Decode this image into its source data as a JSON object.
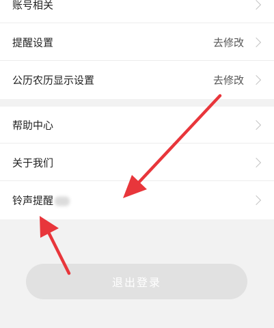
{
  "settings_group_1": [
    {
      "label": "账号相关",
      "value": ""
    },
    {
      "label": "提醒设置",
      "value": "去修改"
    },
    {
      "label": "公历农历显示设置",
      "value": "去修改"
    }
  ],
  "settings_group_2": [
    {
      "label": "帮助中心"
    },
    {
      "label": "关于我们"
    },
    {
      "label": "铃声提醒"
    }
  ],
  "logout_label": "退出登录",
  "annotation_color": "#e8363b"
}
